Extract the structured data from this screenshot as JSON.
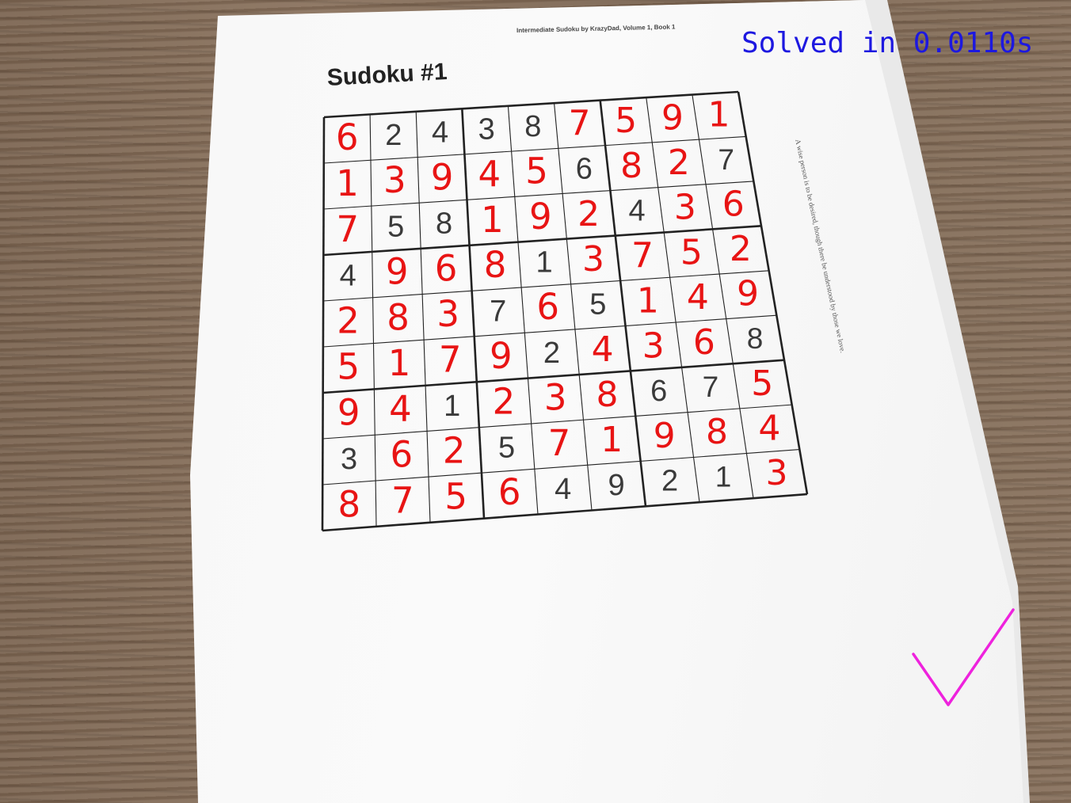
{
  "page": {
    "header_line": "Intermediate Sudoku by KrazyDad, Volume 1, Book 1",
    "title": "Sudoku #1",
    "side_note": "A wise person is to be desired, though there be understood by those we love.",
    "overlay_status": "Solved in 0.0110s"
  },
  "colors": {
    "given_digit": "#3a3a3a",
    "solved_digit": "#e81414",
    "status_text": "#1d18e0",
    "checkmark": "#ee22dd",
    "grid_line": "#222222"
  },
  "icons": {
    "checkmark": "checkmark-icon"
  },
  "sudoku": {
    "rows": [
      [
        6,
        2,
        4,
        3,
        8,
        7,
        5,
        9,
        1
      ],
      [
        1,
        3,
        9,
        4,
        5,
        6,
        8,
        2,
        7
      ],
      [
        7,
        5,
        8,
        1,
        9,
        2,
        4,
        3,
        6
      ],
      [
        4,
        9,
        6,
        8,
        1,
        3,
        7,
        5,
        2
      ],
      [
        2,
        8,
        3,
        7,
        6,
        5,
        1,
        4,
        9
      ],
      [
        5,
        1,
        7,
        9,
        2,
        4,
        3,
        6,
        8
      ],
      [
        9,
        4,
        1,
        2,
        3,
        8,
        6,
        7,
        5
      ],
      [
        3,
        6,
        2,
        5,
        7,
        1,
        9,
        8,
        4
      ],
      [
        8,
        7,
        5,
        6,
        4,
        9,
        2,
        1,
        3
      ]
    ],
    "given_mask": [
      [
        0,
        1,
        1,
        1,
        1,
        0,
        0,
        0,
        0
      ],
      [
        0,
        0,
        0,
        0,
        0,
        1,
        0,
        0,
        1
      ],
      [
        0,
        1,
        1,
        0,
        0,
        0,
        1,
        0,
        0
      ],
      [
        1,
        0,
        0,
        0,
        1,
        0,
        0,
        0,
        0
      ],
      [
        0,
        0,
        0,
        1,
        0,
        1,
        0,
        0,
        0
      ],
      [
        0,
        0,
        0,
        0,
        1,
        0,
        0,
        0,
        1
      ],
      [
        0,
        0,
        1,
        0,
        0,
        0,
        1,
        1,
        0
      ],
      [
        1,
        0,
        0,
        1,
        0,
        0,
        0,
        0,
        0
      ],
      [
        0,
        0,
        0,
        0,
        1,
        1,
        1,
        1,
        0
      ]
    ]
  }
}
